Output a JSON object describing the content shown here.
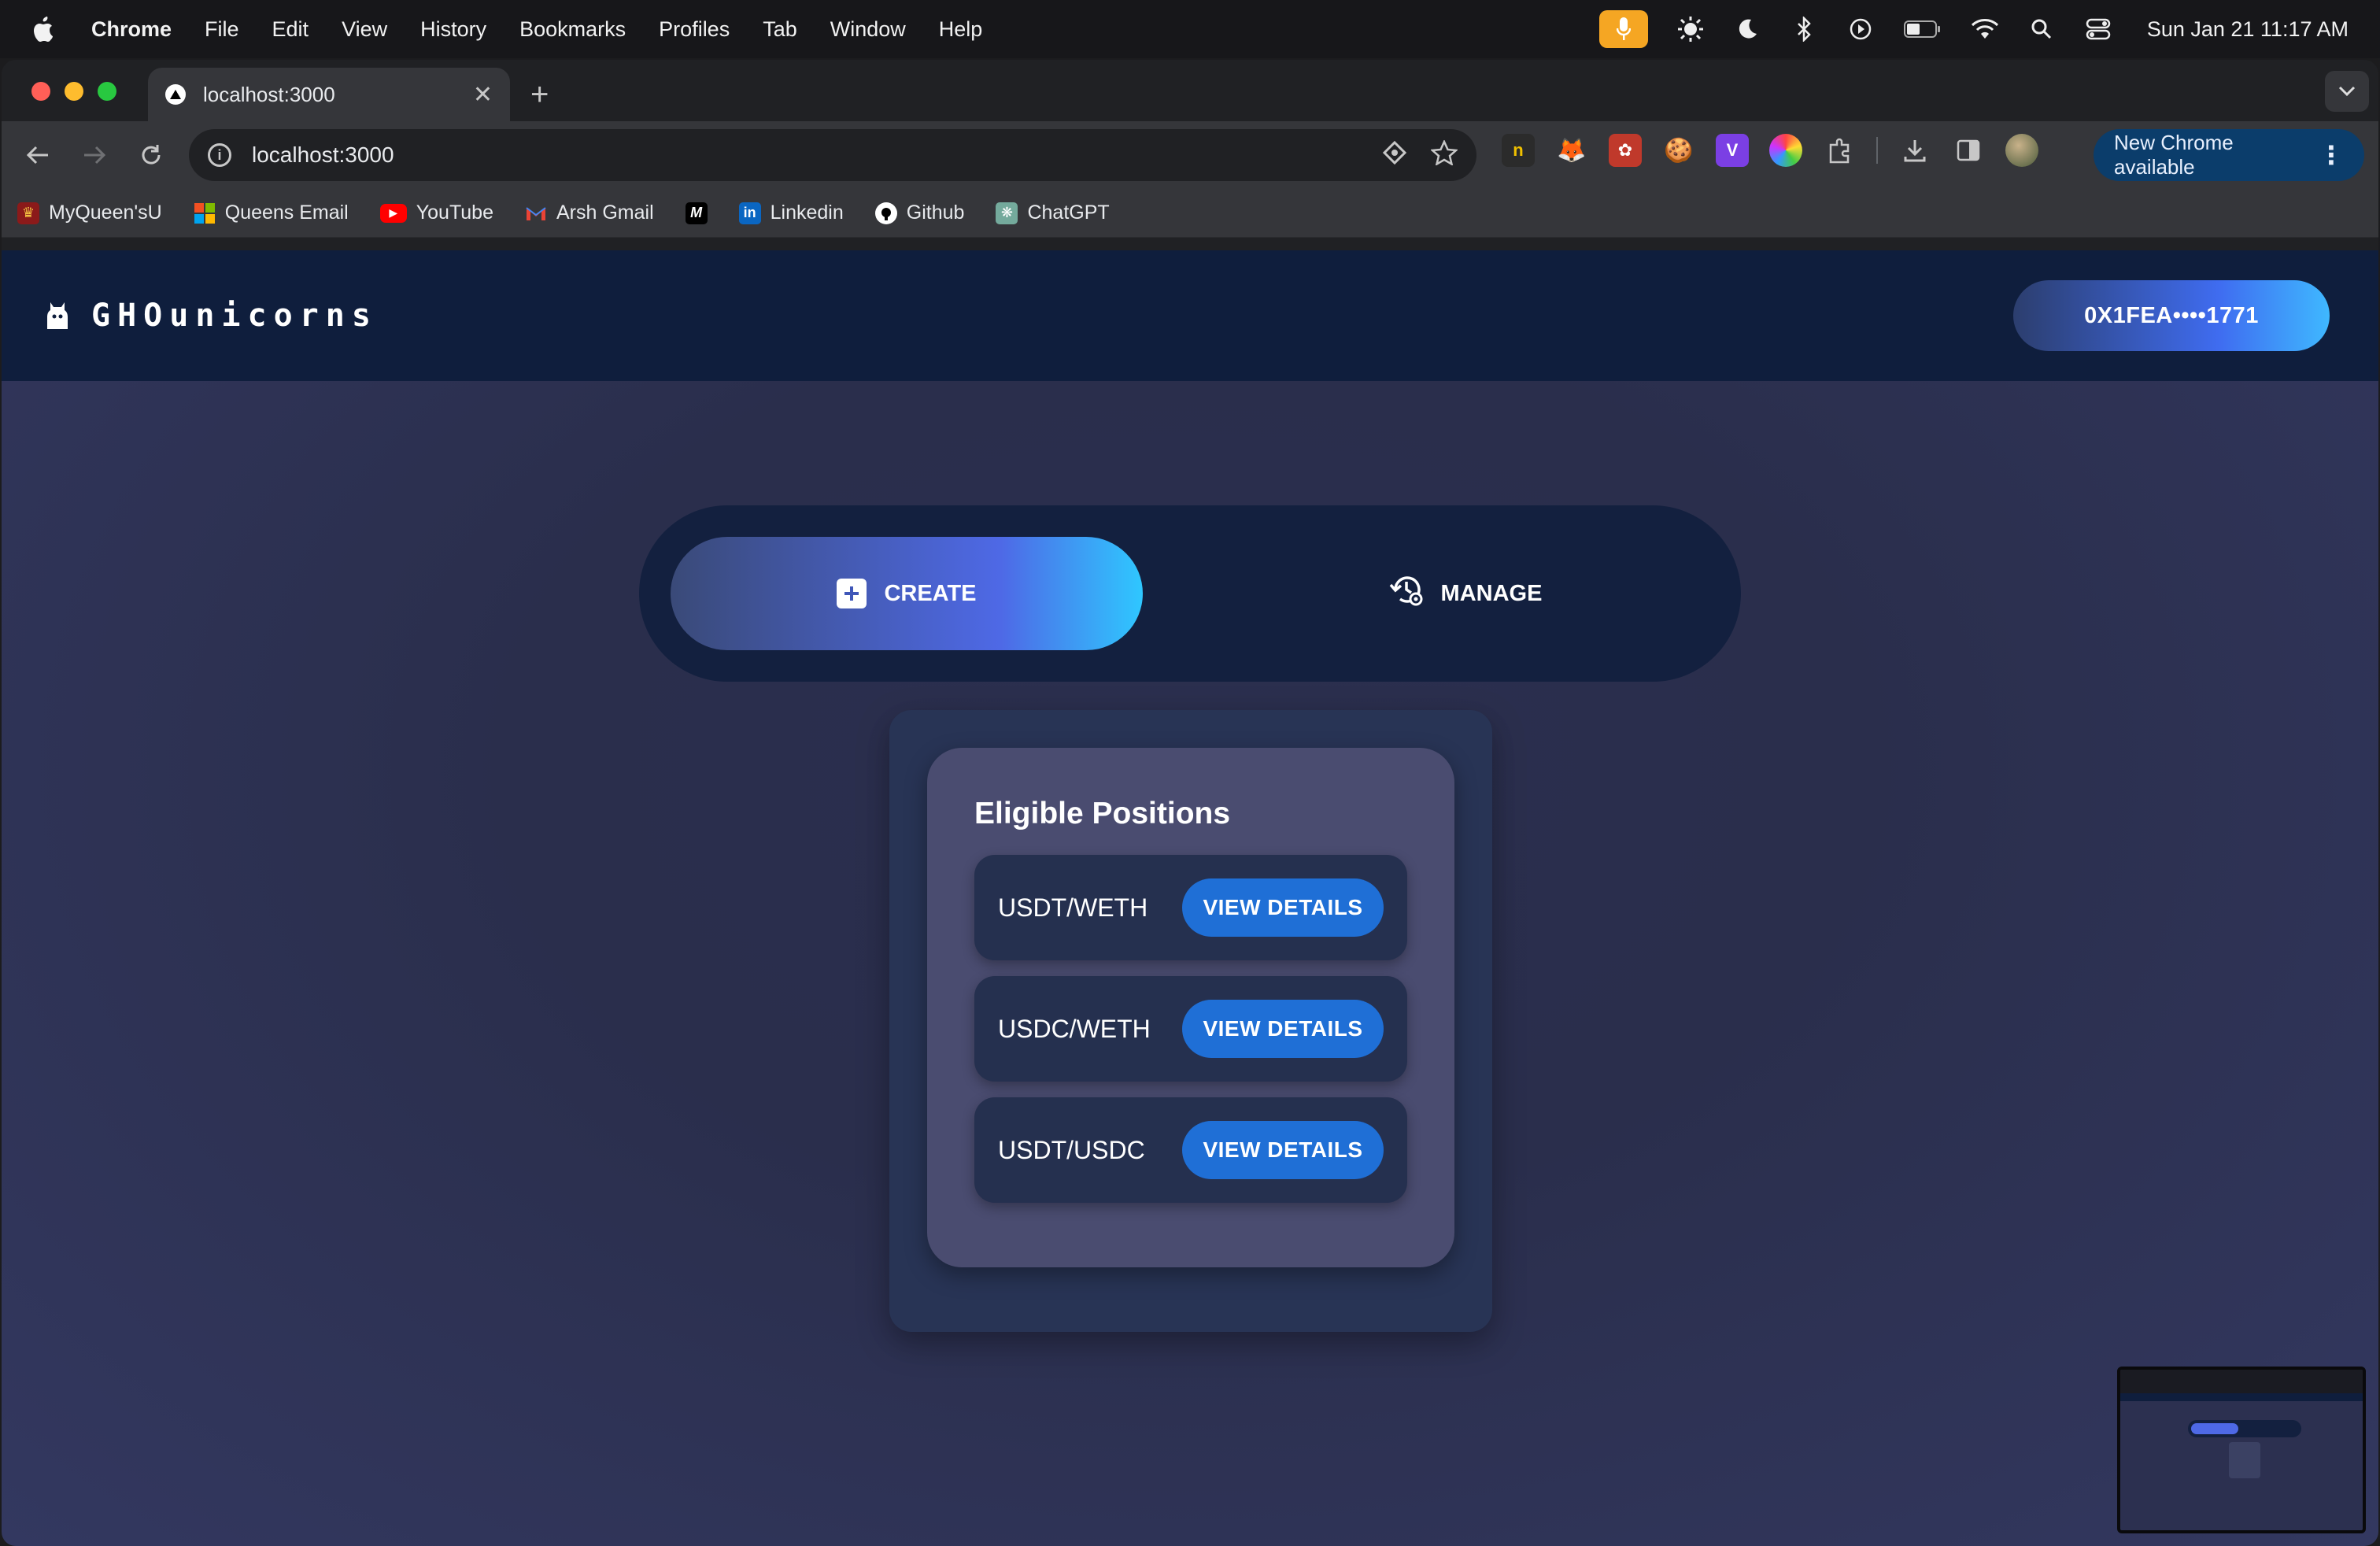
{
  "menubar": {
    "app_name": "Chrome",
    "items": [
      "File",
      "Edit",
      "View",
      "History",
      "Bookmarks",
      "Profiles",
      "Tab",
      "Window",
      "Help"
    ],
    "datetime": "Sun Jan 21  11:17 AM"
  },
  "browser": {
    "tab_title": "localhost:3000",
    "url": "localhost:3000",
    "update_label": "New Chrome available",
    "extensions": [
      "n-icon",
      "metamask-icon",
      "puzzle-red-icon",
      "cookie-icon",
      "v-icon",
      "color-wheel-icon"
    ],
    "bookmarks": [
      {
        "label": "MyQueen'sU",
        "icon": "queens-crest-icon"
      },
      {
        "label": "Queens Email",
        "icon": "microsoft-icon"
      },
      {
        "label": "YouTube",
        "icon": "youtube-icon"
      },
      {
        "label": "Arsh Gmail",
        "icon": "gmail-icon"
      },
      {
        "label": "",
        "icon": "medium-icon"
      },
      {
        "label": "Linkedin",
        "icon": "linkedin-icon"
      },
      {
        "label": "Github",
        "icon": "github-icon"
      },
      {
        "label": "ChatGPT",
        "icon": "chatgpt-icon"
      }
    ]
  },
  "app": {
    "brand": "GHOunicorns",
    "wallet_address": "0X1FEA••••1771",
    "tabs": {
      "create": "CREATE",
      "manage": "MANAGE"
    },
    "positions": {
      "title": "Eligible Positions",
      "items": [
        {
          "pair": "USDT/WETH",
          "action": "VIEW DETAILS"
        },
        {
          "pair": "USDC/WETH",
          "action": "VIEW DETAILS"
        },
        {
          "pair": "USDT/USDC",
          "action": "VIEW DETAILS"
        }
      ]
    }
  },
  "colors": {
    "header_bg": "#0f1e3d",
    "accent_blue": "#1f6fd6",
    "gradient_start": "#3a4a78",
    "gradient_end": "#2fc7ff"
  }
}
